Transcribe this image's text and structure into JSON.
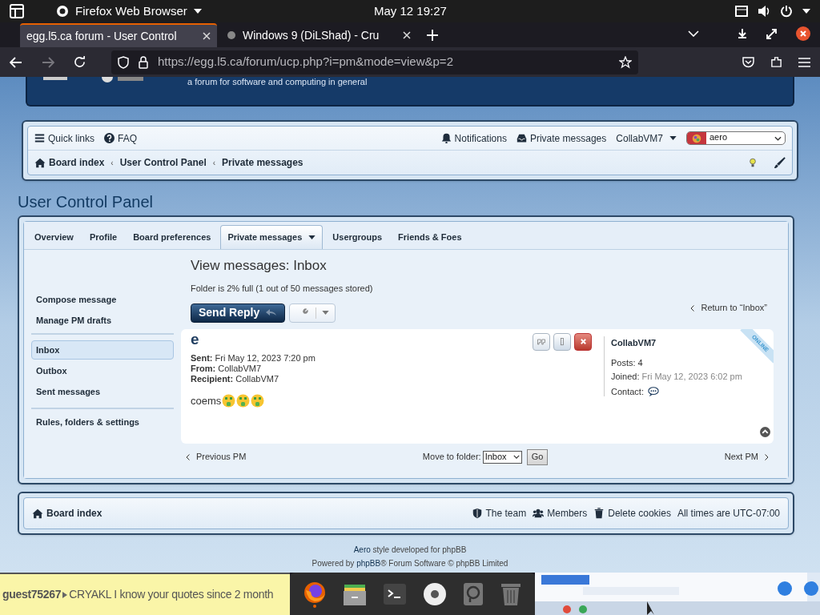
{
  "topbar": {
    "app": "Firefox Web Browser",
    "clock": "May 12  19:27"
  },
  "tabs": [
    {
      "title": "egg.l5.ca forum - User Control",
      "selected": true
    },
    {
      "title": "Windows 9 (DiLShad) - Cru",
      "selected": false
    }
  ],
  "url": "https://egg.l5.ca/forum/ucp.php?i=pm&mode=view&p=2",
  "header": {
    "tagline": "a forum for software and computing in general"
  },
  "navbar": {
    "quick_links": "Quick links",
    "faq": "FAQ",
    "notifications": "Notifications",
    "private_messages": "Private messages",
    "username": "CollabVM7",
    "style_select": "aero",
    "breadcrumb_separator": "‹",
    "breadcrumbs": [
      "Board index",
      "User Control Panel",
      "Private messages"
    ]
  },
  "page_title": "User Control Panel",
  "ucp_tabs": [
    {
      "label": "Overview",
      "selected": false,
      "dropdown": false
    },
    {
      "label": "Profile",
      "selected": false,
      "dropdown": false
    },
    {
      "label": "Board preferences",
      "selected": false,
      "dropdown": false
    },
    {
      "label": "Private messages",
      "selected": true,
      "dropdown": true
    },
    {
      "label": "Usergroups",
      "selected": false,
      "dropdown": false
    },
    {
      "label": "Friends & Foes",
      "selected": false,
      "dropdown": false
    }
  ],
  "sidebar": [
    [
      {
        "label": "Compose message",
        "selected": false
      },
      {
        "label": "Manage PM drafts",
        "selected": false
      }
    ],
    [
      {
        "label": "Inbox",
        "selected": true
      },
      {
        "label": "Outbox",
        "selected": false
      },
      {
        "label": "Sent messages",
        "selected": false
      }
    ],
    [
      {
        "label": "Rules, folders & settings",
        "selected": false
      }
    ]
  ],
  "content": {
    "heading": "View messages: Inbox",
    "folder_status": "Folder is 2% full (1 out of 50 messages stored)",
    "send_reply": "Send Reply",
    "return_link": "Return to “Inbox”",
    "message": {
      "subject": "e",
      "fields": [
        {
          "label": "Sent:",
          "value": "Fri May 12, 2023 7:20 pm"
        },
        {
          "label": "From:",
          "value": "CollabVM7"
        },
        {
          "label": "Recipient:",
          "value": "CollabVM7"
        }
      ],
      "body": "coems"
    },
    "author": {
      "name": "CollabVM7",
      "ribbon": "ONLINE",
      "posts_label": "Posts:",
      "posts": "4",
      "joined_label": "Joined:",
      "joined": "Fri May 12, 2023 6:02 pm",
      "contact_label": "Contact:"
    },
    "prev": "Previous PM",
    "next": "Next PM",
    "move_label": "Move to folder:",
    "folder_select": "Inbox",
    "go": "Go"
  },
  "footer": {
    "board_index": "Board index",
    "links": [
      "The team",
      "Members",
      "Delete cookies"
    ],
    "timezone": "All times are UTC-07:00"
  },
  "credits": [
    [
      {
        "kind": "link",
        "text": "Aero"
      },
      {
        "kind": "text",
        "text": " style developed for phpBB"
      }
    ],
    [
      {
        "kind": "text",
        "text": "Powered by "
      },
      {
        "kind": "link",
        "text": "phpBB"
      },
      {
        "kind": "text",
        "text": "® Forum Software © phpBB Limited"
      }
    ]
  ],
  "ticker": {
    "user": "guest75267",
    "message": "CRYAKL I know your quotes since 2 month"
  }
}
